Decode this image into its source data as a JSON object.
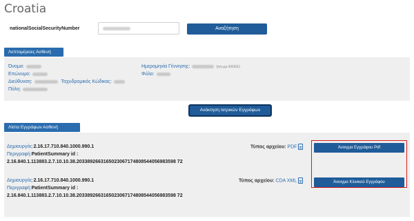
{
  "page": {
    "title": "Croatia"
  },
  "search": {
    "label": "nationalSocialSecurityNumber",
    "button_label": "Αναζήτηση"
  },
  "patient_details": {
    "tab_label": "Λεπτομέρειες Ασθενή",
    "name_label": "Όνομα:",
    "surname_label": "Επώνυμο:",
    "address_label": "Διεύθυνση:",
    "postal_label": "Ταχυδρομικός Κώδικας:",
    "city_label": "Πόλη:",
    "birthdate_label": "Ημερομηνία Γέννησης:",
    "birthdate_hint": "(ηη-μμ-ΕΕΕΕ)",
    "gender_label": "Φύλο:"
  },
  "retrieve_button_label": "Ανάκτηση Ιατρικών Εγγράφων",
  "documents": {
    "tab_label": "Λίστα Εγγράφων Ασθενή",
    "author_label": "Δημιουργός:",
    "description_label": "Περιγραφή:",
    "file_type_label": "Τύπος αρχείου:",
    "items": [
      {
        "author": "2.16.17.710.840.1000.990.1",
        "description": "PatientSummary id :",
        "id": "2.16.840.1.113883.2.7.10.10.38.2033892663165023067174808544056983598 72",
        "file_type": "PDF",
        "button_label": "Άνοιγμα Εγγράφου Pdf"
      },
      {
        "author": "2.16.17.710.840.1000.990.1",
        "description": "PatientSummary id :",
        "id": "2.16.840.1.113883.2.7.10.10.38.2033892663165023067174808544056983598 72",
        "file_type": "CDA XML",
        "button_label": "Άνοιγμα Κλινικού Εγγράφου"
      }
    ]
  },
  "colors": {
    "accent": "#1f5c99",
    "tab": "#2a6cae",
    "highlight": "#d91a1a",
    "panel": "#efefef"
  }
}
